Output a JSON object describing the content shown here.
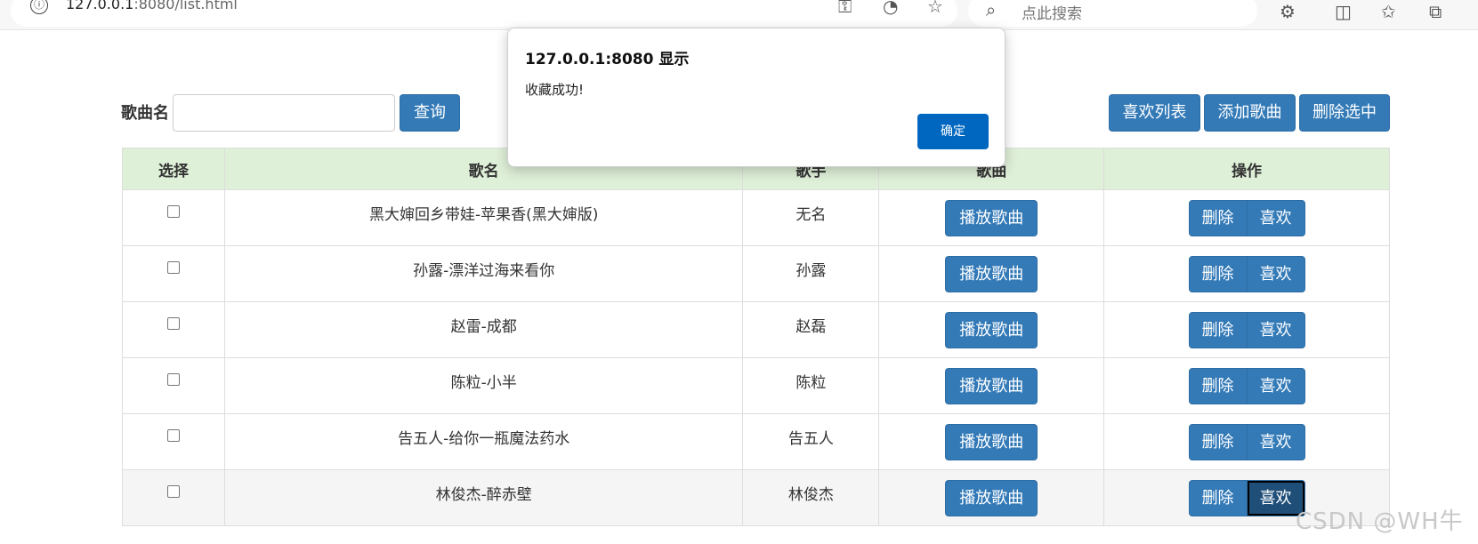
{
  "browser": {
    "url_host": "127.0.0.1",
    "url_rest": ":8080/list.html",
    "search_placeholder": "点此搜索",
    "info_icon": "ⓘ"
  },
  "search": {
    "label": "歌曲名",
    "value": "",
    "button": "查询"
  },
  "actions": {
    "favorites": "喜欢列表",
    "add": "添加歌曲",
    "delete_selected": "删除选中"
  },
  "table": {
    "headers": [
      "选择",
      "歌名",
      "歌手",
      "歌曲",
      "操作"
    ],
    "rows": [
      {
        "title": "黑大婶回乡带娃-苹果香(黑大婶版)",
        "singer": "无名",
        "play": "播放歌曲",
        "delete": "删除",
        "like": "喜欢"
      },
      {
        "title": "孙露-漂洋过海来看你",
        "singer": "孙露",
        "play": "播放歌曲",
        "delete": "删除",
        "like": "喜欢"
      },
      {
        "title": "赵雷-成都",
        "singer": "赵磊",
        "play": "播放歌曲",
        "delete": "删除",
        "like": "喜欢"
      },
      {
        "title": "陈粒-小半",
        "singer": "陈粒",
        "play": "播放歌曲",
        "delete": "删除",
        "like": "喜欢"
      },
      {
        "title": "告五人-给你一瓶魔法药水",
        "singer": "告五人",
        "play": "播放歌曲",
        "delete": "删除",
        "like": "喜欢"
      },
      {
        "title": "林俊杰-醉赤壁",
        "singer": "林俊杰",
        "play": "播放歌曲",
        "delete": "删除",
        "like": "喜欢"
      }
    ]
  },
  "dialog": {
    "title": "127.0.0.1:8080 显示",
    "message": "收藏成功!",
    "ok": "确定"
  },
  "watermark": "CSDN @WH牛",
  "colors": {
    "primary": "#337ab7",
    "header_bg": "#dff0d8",
    "dialog_button": "#0067c0"
  }
}
